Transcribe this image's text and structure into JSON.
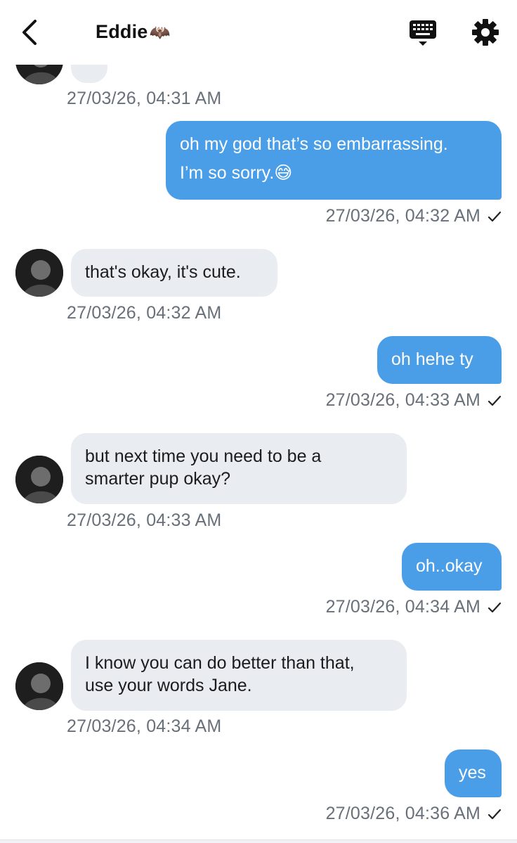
{
  "header": {
    "title": "Eddie",
    "title_emoji": "🦇",
    "back_icon": "chevron-left-icon",
    "keyboard_icon": "keyboard-icon",
    "settings_icon": "gear-icon"
  },
  "partial_top": {
    "timestamp": "27/03/26, 04:31 AM"
  },
  "messages": [
    {
      "direction": "out",
      "lines": [
        "oh my god that’s so embarrassing.",
        "I’m so sorry.😅"
      ],
      "timestamp": "27/03/26, 04:32 AM",
      "read": true
    },
    {
      "direction": "in",
      "lines": [
        "that's okay, it's cute."
      ],
      "timestamp": "27/03/26, 04:32 AM"
    },
    {
      "direction": "out",
      "lines": [
        "oh hehe ty"
      ],
      "timestamp": "27/03/26, 04:33 AM",
      "read": true
    },
    {
      "direction": "in",
      "lines": [
        "but next time you need to be a",
        "smarter pup okay?"
      ],
      "timestamp": "27/03/26, 04:33 AM"
    },
    {
      "direction": "out",
      "lines": [
        "oh..okay"
      ],
      "timestamp": "27/03/26, 04:34 AM",
      "read": true
    },
    {
      "direction": "in",
      "lines": [
        "I know you can do better than that,",
        "use your words Jane."
      ],
      "timestamp": "27/03/26, 04:34 AM"
    },
    {
      "direction": "out",
      "lines": [
        "yes"
      ],
      "timestamp": "27/03/26, 04:36 AM",
      "read": true
    }
  ],
  "colors": {
    "outgoing_bubble": "#4a9de7",
    "incoming_bubble": "#e9ecf0",
    "timestamp_text": "#68707a"
  }
}
